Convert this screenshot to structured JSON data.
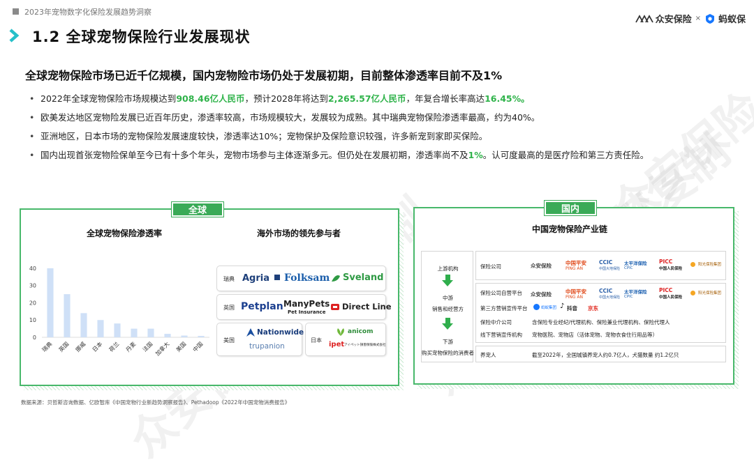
{
  "header": {
    "series": "2023年宠物数字化保险发展趋势洞察",
    "logo_zhongan": "众安保险",
    "logo_ant": "蚂蚁保",
    "times": "×"
  },
  "title": "1.2  全球宠物保险行业发展现状",
  "subtitle": "全球宠物保险市场已近千亿规模，国内宠物险市场仍处于发展初期，目前整体渗透率目前不及1%",
  "bullets": [
    {
      "a": "2022年全球宠物保险市场规模达到",
      "h1": "908.46亿人民币",
      "b": "，预计2028年将达到",
      "h2": "2,265.57亿人民币",
      "c": "，年复合增长率高达",
      "h3": "16.45%。"
    },
    {
      "text": "欧美发达地区宠物险发展已近百年历史，渗透率较高，市场规模较大，发展较为成熟。其中瑞典宠物保险渗透率最高，约为40%。"
    },
    {
      "text": "亚洲地区，日本市场的宠物保险发展速度较快，渗透率达10%；宠物保护及保险意识较强，许多新宠到家即买保险。"
    },
    {
      "a": "国内出现首张宠物险保单至今已有十多个年头，宠物市场参与主体逐渐多元。但仍处在发展初期，渗透率尚不及",
      "h1": "1%",
      "b": "。认可度最高的是医疗险和第三方责任险。"
    }
  ],
  "global_panel": {
    "tag": "全球",
    "chart_title": "全球宠物保险渗透率",
    "overseas_title": "海外市场的领先参与者"
  },
  "chart_data": {
    "type": "bar",
    "title": "全球宠物保险渗透率",
    "categories": [
      "瑞典",
      "英国",
      "挪威",
      "日本",
      "荷兰",
      "丹麦",
      "法国",
      "加拿大",
      "美国",
      "中国"
    ],
    "values": [
      40,
      25,
      14,
      10,
      8,
      5,
      5,
      2,
      1,
      0.8
    ],
    "yticks": [
      0,
      10,
      20,
      30,
      40
    ],
    "ylim": [
      0,
      42
    ],
    "color": "#cfe0f7"
  },
  "overseas": {
    "sweden": {
      "label": "瑞典",
      "brands": [
        "Agria",
        "Folksam",
        "Sveland"
      ]
    },
    "uk": {
      "label": "英国",
      "brands": [
        "Petplan",
        "ManyPets",
        "Direct Line"
      ],
      "manypets_sub": "Pet Insurance"
    },
    "us": {
      "label": "美国",
      "brands": [
        "Nationwide",
        "trupanion"
      ]
    },
    "japan": {
      "label": "日本",
      "brands": [
        "anicom",
        "ipet"
      ],
      "ipet_sub": "アイペット損害保険株式会社"
    }
  },
  "domestic_panel": {
    "tag": "国内",
    "chain_title": "中国宠物保险产业链",
    "left": {
      "upstream": "上游机构",
      "midstream": "中游",
      "midstream_desc": "销售和经营方",
      "downstream": "下游",
      "downstream_desc": "购买宠物保险的消费者"
    },
    "rows": [
      {
        "label": "保险公司"
      },
      {
        "label": "保险公司自营平台"
      },
      {
        "label": "第三方营销宣传平台"
      },
      {
        "label": "保险中介公司",
        "desc": "含保险专业经纪/代理机构、保险兼业代理机构、保险代理人"
      },
      {
        "label": "线下营销宣传机构",
        "desc": "宠物医院、宠物店（活体宠物、宠物衣食住行用品等）"
      },
      {
        "label": "养宠人",
        "desc": "截至2022年，全国城镇养宠人约0.7亿人，犬猫数量 约1.2亿只"
      }
    ],
    "insurers": [
      "众安保险",
      "中国平安",
      "CCIC",
      "太平洋保险",
      "PICC",
      "阳光保险"
    ],
    "insurer_subs": [
      "",
      "PING AN",
      "中国大地保险",
      "CPIC",
      "中国人民保险",
      "阳光保险集团"
    ],
    "third_party": [
      "蚂蚁集团",
      "抖音",
      "京东"
    ]
  },
  "source": "数据来源：贝哲斯咨询数据、亿欧智库《中国宠物行业新趋势洞察报告》、Pethadoop《2022年中国宠物消费报告》",
  "watermark": "众安保险 严禁复制"
}
